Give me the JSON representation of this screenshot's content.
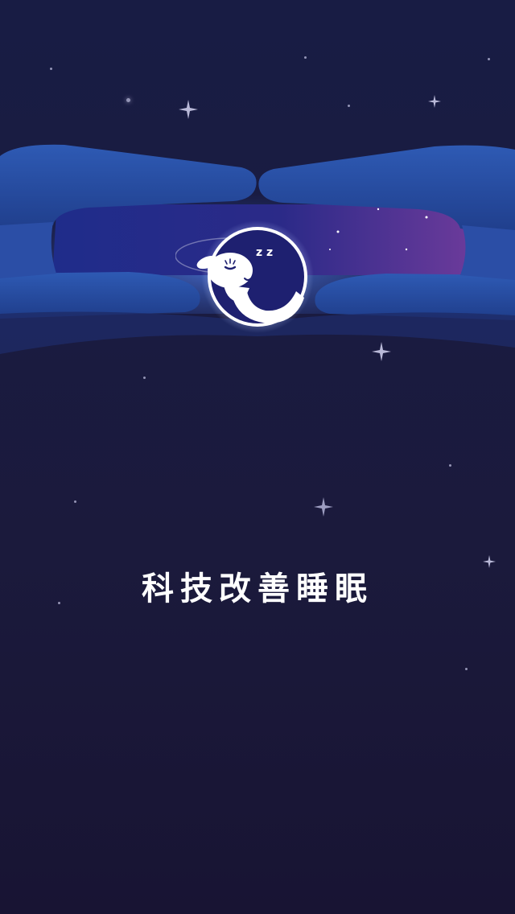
{
  "splash": {
    "slogan": "科技改善睡眠",
    "logo_icon": "sleeping-sheep-moon-icon",
    "snore_text": "z z"
  },
  "colors": {
    "background_top": "#181c44",
    "background_bottom": "#181433",
    "hands": "#2a4a9a",
    "window_sky": "#23237a",
    "logo_circle": "#1e2070",
    "sheep": "#ffffff",
    "slogan_text": "#ffffff"
  },
  "icons": {
    "stars": "sparkle-star-icon",
    "hands": "framing-hands-illustration"
  }
}
